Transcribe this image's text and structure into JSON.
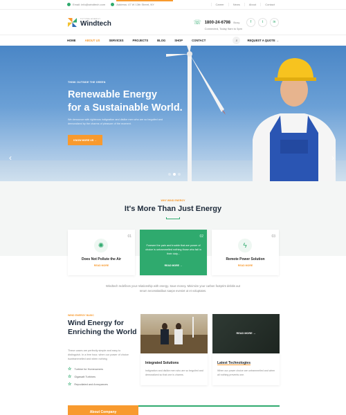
{
  "topbar": {
    "email": "Email: info@windtech.com",
    "address": "Address: 47 W 13th Street, NY",
    "links": [
      "Career",
      "News",
      "About",
      "Contact"
    ]
  },
  "brand": {
    "tagline": "FUTURE ENERGY",
    "name": "Windtech"
  },
  "contact": {
    "phone": "1800-24-6798",
    "phone_suffix": "Busy",
    "hours": "Connected, Today 9am to 5pm"
  },
  "socials": [
    "f",
    "t",
    "in"
  ],
  "nav": {
    "items": [
      "HOME",
      "ABOUT US",
      "SERVICES",
      "PROJECTS",
      "BLOG",
      "SHOP",
      "CONTACT"
    ],
    "active_index": 1,
    "quote": "REQUEST A QUOTE"
  },
  "hero": {
    "kicker": "THINK OUTSIDE THE GREEN",
    "title_line1": "Renewable Energy",
    "title_line2": "for a Sustainable World.",
    "description": "We denounce with righteous indignation and dislike men who are so beguiled and demoralized by the charms of pleasure of the moment.",
    "button": "KNOW MORE US"
  },
  "section2": {
    "kicker": "WHY WIND ENERGY",
    "title": "It's More Than Just Energy"
  },
  "cards": [
    {
      "num": "01",
      "title": "Does Not Pollute the Air",
      "link": "READ MORE"
    },
    {
      "num": "02",
      "text": "Foresee the pain and trouble that are power of choice is untrammelled nothing those who fail in their duty...",
      "link": "READ MORE"
    },
    {
      "num": "03",
      "title": "Remote Power Solution",
      "link": "READ MORE"
    }
  ],
  "intro": "Windtech redefines your relationship with energy. Save money. Minimize your carbon footprint debitis aut rerum necessitatibus saepe eveniet ut et voluptates.",
  "wind": {
    "kicker": "WIND ENERGY BASIC",
    "title_line1": "Wind Energy for",
    "title_line2": "Enriching the World",
    "description": "These cases are perfectly simple and easy to distinguish. In a free hour, when our power of choice isuntrammelled and when nothing",
    "bullets": [
      "Turbine for Homeowners",
      "Gigawatt Turbines",
      "Repudiated and Annoyances"
    ]
  },
  "posts": [
    {
      "title": "Integrated Solutions",
      "text": "Indignation and dislike men who are so beguiled and demoralized so that one is charms."
    },
    {
      "title": "Latest Technologies",
      "text": "When our power choice are untrammelled and when all nothing prevents one.",
      "overlay": "READ MORE"
    }
  ],
  "bottom_tab": "About Company",
  "colors": {
    "accent": "#f89a2e",
    "green": "#2faa6e",
    "dark": "#1d2a3a"
  }
}
